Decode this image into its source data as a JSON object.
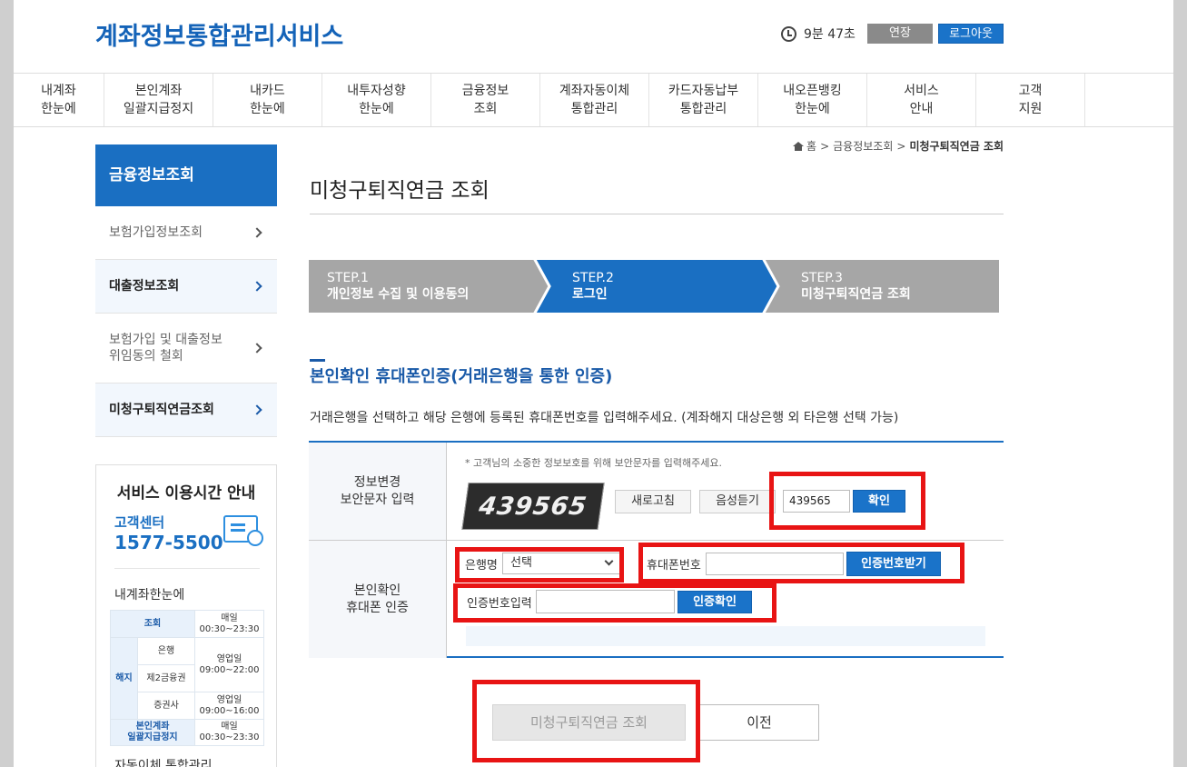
{
  "header": {
    "logo": "계좌정보통합관리서비스",
    "timer": "9분 47초",
    "extend_label": "연장",
    "logout_label": "로그아웃"
  },
  "gnb": [
    {
      "label": "내계좌\n한눈에"
    },
    {
      "label": "본인계좌\n일괄지급정지"
    },
    {
      "label": "내카드\n한눈에"
    },
    {
      "label": "내투자성향\n한눈에"
    },
    {
      "label": "금융정보\n조회"
    },
    {
      "label": "계좌자동이체\n통합관리"
    },
    {
      "label": "카드자동납부\n통합관리"
    },
    {
      "label": "내오픈뱅킹\n한눈에"
    },
    {
      "label": "서비스\n안내"
    },
    {
      "label": "고객\n지원"
    }
  ],
  "lnb": {
    "title": "금융정보조회",
    "items": [
      {
        "label": "보험가입정보조회"
      },
      {
        "label": "대출정보조회"
      },
      {
        "label": "보험가입 및 대출정보\n위임동의 철회"
      },
      {
        "label": "미청구퇴직연금조회"
      }
    ]
  },
  "service": {
    "title": "서비스 이용시간 안내",
    "center": "고객센터",
    "phone": "1577-5500",
    "sub": "내계좌한눈에",
    "rows": {
      "lookup": "조회",
      "lookup_time": "매일\n00:30~23:30",
      "cancel": "해지",
      "bank": "은행",
      "bank_time": "영업일\n09:00~22:00",
      "fin2": "제2금융권",
      "sec": "증권사",
      "sec_time": "영업일\n09:00~16:00",
      "stop": "본인계좌\n일괄지급정지",
      "stop_time": "매일\n00:30~23:30"
    },
    "next": "자동이체 통합관리"
  },
  "breadcrumb": {
    "home": "홈",
    "level1": "금융정보조회",
    "current": "미청구퇴직연금 조회"
  },
  "page_title": "미청구퇴직연금 조회",
  "steps": [
    {
      "num": "STEP.1",
      "label": "개인정보 수집 및 이용동의"
    },
    {
      "num": "STEP.2",
      "label": "로그인"
    },
    {
      "num": "STEP.3",
      "label": "미청구퇴직연금 조회"
    }
  ],
  "section": {
    "title": "본인확인 휴대폰인증(거래은행을 통한 인증)",
    "desc": "거래은행을 선택하고 해당 은행에 등록된 휴대폰번호를 입력해주세요. (계좌해지 대상은행 외 타은행 선택 가능)"
  },
  "form": {
    "captcha_header": "정보변경\n보안문자 입력",
    "captcha_note": "* 고객님의 소중한 정보보호를 위해 보안문자를 입력해주세요.",
    "captcha_image_text": "439565",
    "refresh_label": "새로고침",
    "audio_label": "음성듣기",
    "captcha_value": "439565",
    "confirm_label": "확인",
    "phone_header": "본인확인\n휴대폰 인증",
    "bank_label": "은행명",
    "bank_selected": "선택",
    "phone_label": "휴대폰번호",
    "phone_value": "",
    "request_code_label": "인증번호받기",
    "code_label": "인증번호입력",
    "code_value": "",
    "verify_label": "인증확인"
  },
  "buttons": {
    "submit_label": "미청구퇴직연금 조회",
    "prev_label": "이전"
  },
  "colors": {
    "brand": "#1a6fc2",
    "highlight": "#e81414",
    "step_active": "#1a6fc2",
    "step_inactive": "#a6a6a6"
  }
}
